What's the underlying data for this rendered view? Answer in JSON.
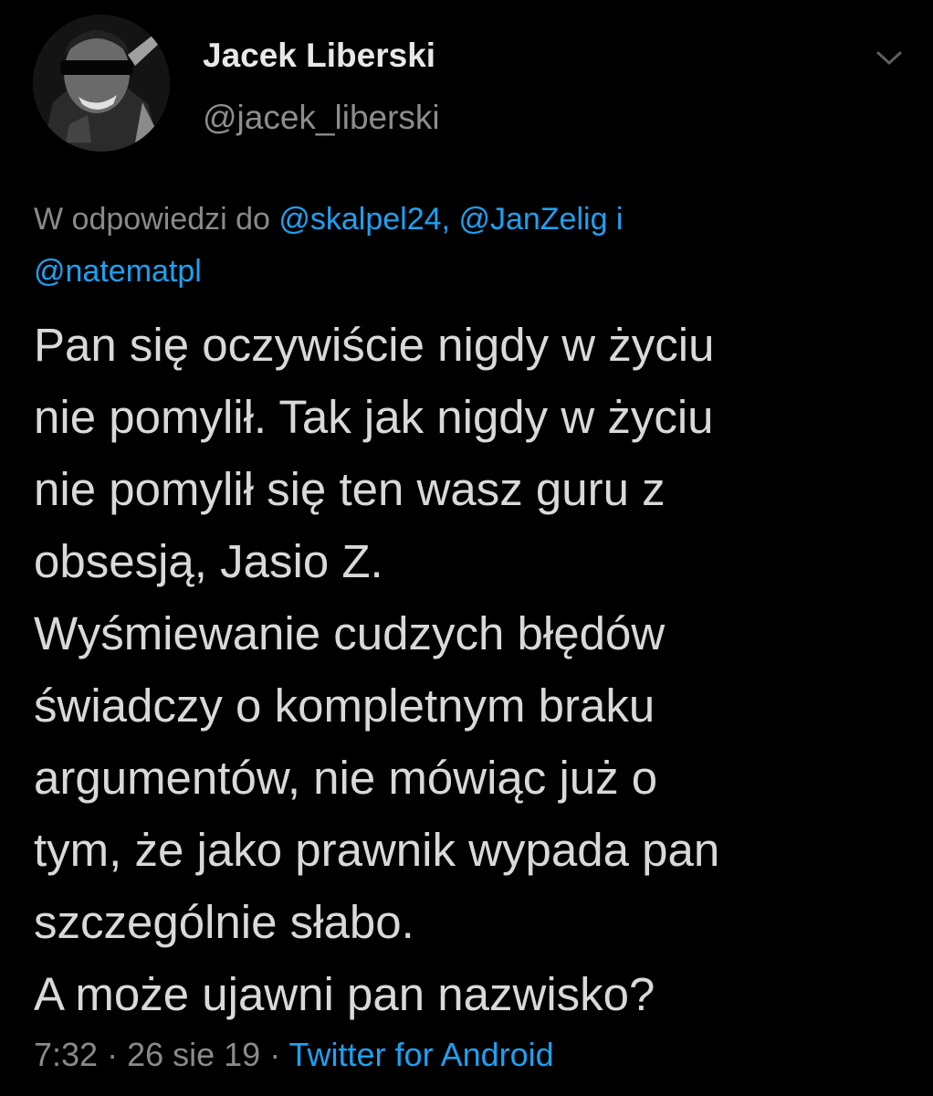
{
  "author": {
    "display_name": "Jacek Liberski",
    "handle": "@jacek_liberski",
    "avatar_icon": "profile-photo"
  },
  "reply": {
    "prefix": "W odpowiedzi do ",
    "mentions": [
      "@skalpel24,",
      "@JanZelig",
      "@natematpl"
    ],
    "conjunction": " i "
  },
  "tweet": {
    "lines": [
      "Pan się oczywiście nigdy w życiu",
      "nie pomylił. Tak jak nigdy w życiu",
      "nie pomylił się ten wasz guru z",
      "obsesją, Jasio Z.",
      "Wyśmiewanie cudzych błędów",
      "świadczy o kompletnym braku",
      "argumentów, nie mówiąc już o",
      "tym, że jako prawnik wypada pan",
      "szczególnie słabo.",
      "A może ujawni pan nazwisko?"
    ]
  },
  "meta": {
    "time": "7:32",
    "separator": " · ",
    "date": "26 sie 19",
    "source": "Twitter for Android"
  },
  "colors": {
    "background": "#000000",
    "text": "#d9d9d9",
    "secondary": "#8a8a8a",
    "link": "#1da1f2"
  },
  "icons": {
    "more": "chevron-down-icon"
  }
}
